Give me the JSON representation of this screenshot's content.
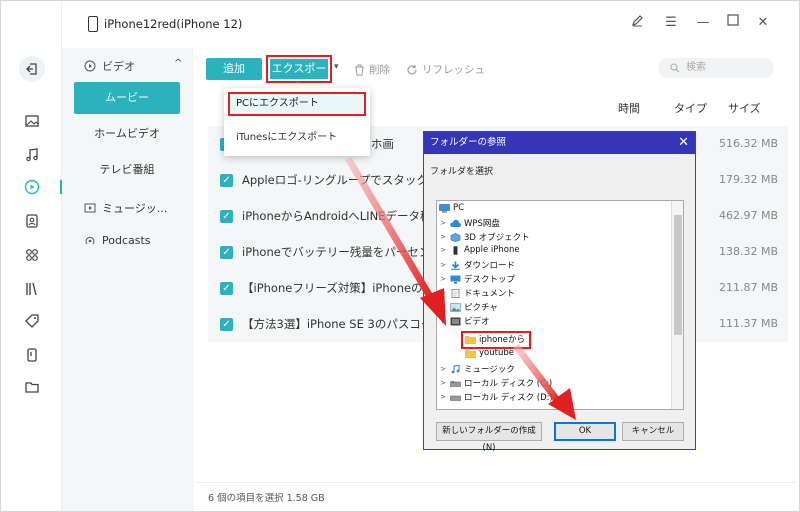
{
  "window": {
    "device_title": "iPhone12red(iPhone 12)",
    "controls": [
      "edit-icon",
      "menu-icon",
      "minimize-icon",
      "maximize-icon",
      "close-icon"
    ]
  },
  "rail": {
    "icons": [
      "back-icon",
      "photo-icon",
      "music-icon",
      "video-icon",
      "contacts-icon",
      "apps-icon",
      "books-icon",
      "tag-icon",
      "device-icon",
      "folder-icon"
    ],
    "active_icon": "video-icon",
    "accent_color": "#2ab3bd"
  },
  "sidebar": {
    "category": "ビデオ",
    "items": [
      {
        "label": "ムービー",
        "active": true
      },
      {
        "label": "ホームビデオ",
        "active": false
      },
      {
        "label": "テレビ番組",
        "active": false
      }
    ],
    "sections": [
      {
        "label": "ミュージッ...",
        "icon": "music-video-icon"
      },
      {
        "label": "Podcasts",
        "icon": "podcast-icon"
      }
    ]
  },
  "toolbar": {
    "add_label": "追加",
    "export_label": "エクスポート",
    "delete_label": "削除",
    "refresh_label": "リフレッシュ",
    "search_placeholder": "検索"
  },
  "export_menu": {
    "items": [
      "PCにエクスポート",
      "iTunesにエクスポート"
    ],
    "highlighted": "PCにエクスポート"
  },
  "table": {
    "columns": [
      "時間",
      "タイプ",
      "サイズ"
    ],
    "rows": [
      {
        "name": "iPhoneからAndroidスマホ画",
        "size": "516.32 MB",
        "checked": true
      },
      {
        "name": "Appleロゴ-リングループでスタックして",
        "size": "179.32 MB",
        "checked": true
      },
      {
        "name": "iPhoneからAndroidへLINEデータ移行",
        "size": "462.97 MB",
        "checked": true
      },
      {
        "name": "iPhoneでバッテリー残量をパーセン",
        "size": "138.32 MB",
        "checked": true
      },
      {
        "name": "【iPhoneフリーズ対策】iPhoneの画面",
        "size": "211.87 MB",
        "checked": true
      },
      {
        "name": "【方法3選】iPhone SE 3のパスコードを",
        "size": "111.37 MB",
        "checked": true
      }
    ]
  },
  "status": {
    "text": "6 個の項目を選択 1.58 GB"
  },
  "folder_dialog": {
    "title": "フォルダーの参照",
    "prompt": "フォルダを選択",
    "tree": [
      {
        "label": "PC",
        "icon": "pc-icon",
        "level": 0,
        "expander": ""
      },
      {
        "label": "WPS网盘",
        "icon": "cloud-icon",
        "level": 1,
        "expander": ">"
      },
      {
        "label": "3D オブジェクト",
        "icon": "cube-icon",
        "level": 1,
        "expander": ">"
      },
      {
        "label": "Apple iPhone",
        "icon": "phone-icon",
        "level": 1,
        "expander": ">"
      },
      {
        "label": "ダウンロード",
        "icon": "download-icon",
        "level": 1,
        "expander": ">"
      },
      {
        "label": "デスクトップ",
        "icon": "desktop-icon",
        "level": 1,
        "expander": ">"
      },
      {
        "label": "ドキュメント",
        "icon": "document-icon",
        "level": 1,
        "expander": ">"
      },
      {
        "label": "ピクチャ",
        "icon": "picture-icon",
        "level": 1,
        "expander": ">"
      },
      {
        "label": "ビデオ",
        "icon": "video-folder-icon",
        "level": 1,
        "expander": "v"
      },
      {
        "label": "iphoneから",
        "icon": "folder-icon",
        "level": 2,
        "expander": "",
        "selected": true
      },
      {
        "label": "youtube",
        "icon": "folder-icon",
        "level": 2,
        "expander": ""
      },
      {
        "label": "ミュージック",
        "icon": "music-folder-icon",
        "level": 1,
        "expander": ">"
      },
      {
        "label": "ローカル ディスク (C:)",
        "icon": "drive-icon",
        "level": 1,
        "expander": ">"
      },
      {
        "label": "ローカル ディスク (D:)",
        "icon": "drive-icon",
        "level": 1,
        "expander": ">"
      }
    ],
    "new_folder_label": "新しいフォルダーの作成(N)",
    "ok_label": "OK",
    "cancel_label": "キャンセル"
  }
}
